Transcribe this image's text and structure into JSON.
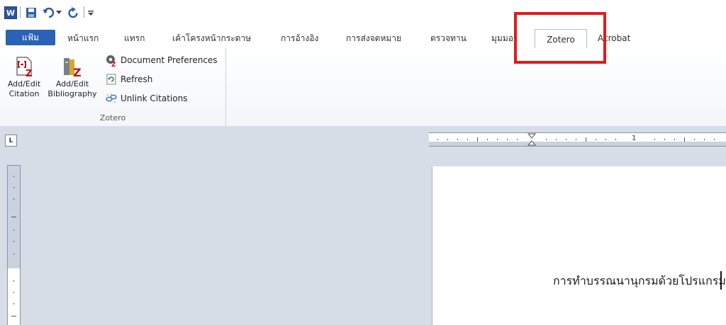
{
  "qat": {
    "app_icon": "word-icon",
    "app_icon_letter": "W",
    "items": [
      "save-icon",
      "undo-icon",
      "dropdown-arrow-icon",
      "redo-icon",
      "customize-icon"
    ]
  },
  "tabs": {
    "file": "แฟ้ม",
    "items": [
      "หน้าแรก",
      "แทรก",
      "เค้าโครงหน้ากระดาษ",
      "การอ้างอิง",
      "การส่งจดหมาย",
      "ตรวจทาน",
      "มุมมอง",
      "Zotero",
      "Acrobat"
    ],
    "active": "Zotero"
  },
  "ribbon": {
    "add_edit_citation": "Add/Edit Citation",
    "add_edit_bibliography": "Add/Edit Bibliography",
    "document_preferences": "Document Preferences",
    "refresh": "Refresh",
    "unlink_citations": "Unlink Citations",
    "group_label": "Zotero"
  },
  "ruler": {
    "tab_selector": "L",
    "mark_1": "1"
  },
  "document": {
    "text": "การทำบรรณนานุกรมด้วยโปรแกรม"
  },
  "colors": {
    "file_tab": "#2a62b5",
    "highlight": "#e11b1b",
    "workspace": "#d6dde7"
  }
}
